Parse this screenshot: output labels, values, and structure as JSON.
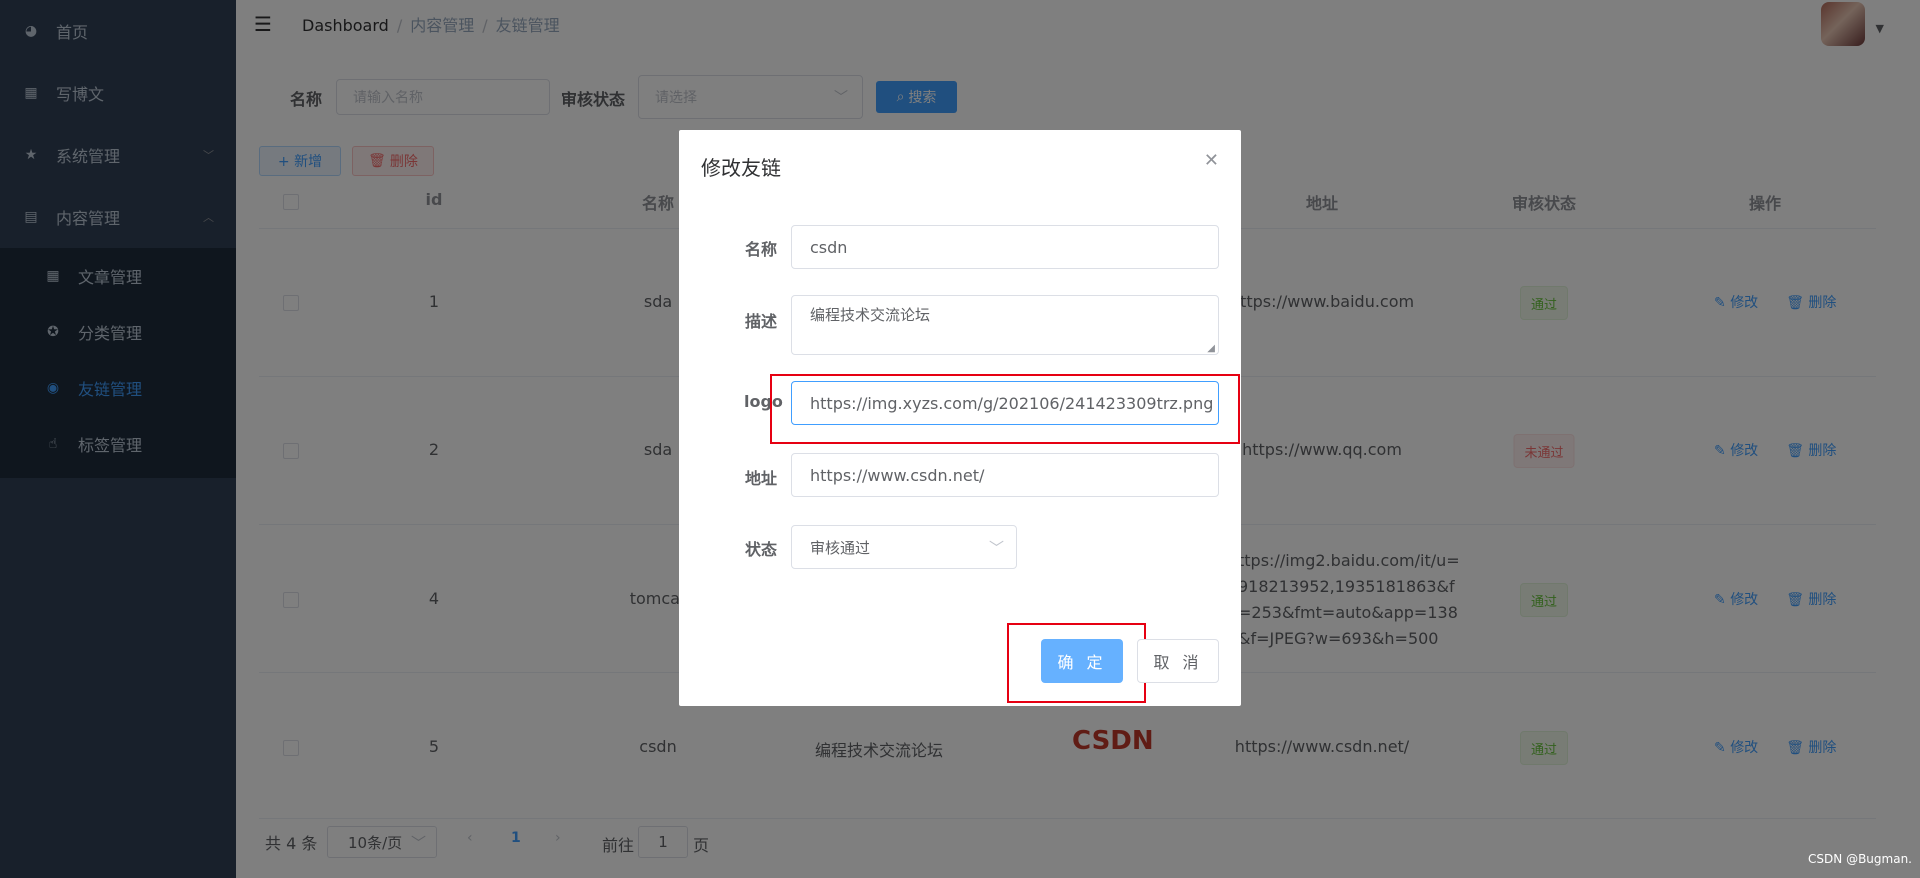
{
  "sidebar": {
    "items": [
      {
        "label": "首页",
        "icon": "dashboard-icon"
      },
      {
        "label": "写博文",
        "icon": "edit-icon"
      },
      {
        "label": "系统管理",
        "icon": "star-icon"
      },
      {
        "label": "内容管理",
        "icon": "table-icon"
      }
    ],
    "sub_items": [
      {
        "label": "文章管理",
        "icon": "grid-icon"
      },
      {
        "label": "分类管理",
        "icon": "category-icon"
      },
      {
        "label": "友链管理",
        "icon": "link-icon"
      },
      {
        "label": "标签管理",
        "icon": "tag-icon"
      }
    ]
  },
  "header": {
    "breadcrumb": [
      "Dashboard",
      "内容管理",
      "友链管理"
    ]
  },
  "filter": {
    "name_label": "名称",
    "name_placeholder": "请输入名称",
    "status_label": "审核状态",
    "status_placeholder": "请选择",
    "search_label": "搜索"
  },
  "toolbar": {
    "add_label": "+ 新增",
    "delete_label": "删除"
  },
  "table": {
    "headers": [
      "id",
      "名称",
      "地址",
      "审核状态",
      "操作"
    ],
    "rows": [
      {
        "id": "1",
        "name": "sda",
        "url": "https://www.baidu.com",
        "status": "通过"
      },
      {
        "id": "2",
        "name": "sda",
        "url": "https://www.qq.com",
        "status": "未通过"
      },
      {
        "id": "4",
        "name": "tomcat",
        "url_lines": [
          "ttps://img2.baidu.com/it/u=",
          "918213952,1935181863&f",
          "=253&fmt=auto&app=138",
          "&f=JPEG?w=693&h=500"
        ],
        "status": "通过"
      },
      {
        "id": "5",
        "name": "csdn",
        "desc": "编程技术交流论坛",
        "logo_text": "CSDN",
        "url": "https://www.csdn.net/",
        "status": "通过"
      }
    ],
    "edit_label": "修改",
    "delete_label": "删除"
  },
  "pagination": {
    "total": "共 4 条",
    "page_size": "10条/页",
    "current_page": "1",
    "goto_label": "前往",
    "goto_value": "1",
    "page_unit": "页"
  },
  "dialog": {
    "title": "修改友链",
    "fields": {
      "name_label": "名称",
      "name_value": "csdn",
      "desc_label": "描述",
      "desc_value": "编程技术交流论坛",
      "logo_label": "logo",
      "logo_value": "https://img.xyzs.com/g/202106/241423309trz.png",
      "url_label": "地址",
      "url_value": "https://www.csdn.net/",
      "status_label": "状态",
      "status_value": "审核通过"
    },
    "ok_label": "确 定",
    "cancel_label": "取 消"
  },
  "watermark": "CSDN @Bugman.",
  "colors": {
    "primary": "#409eff",
    "sidebar": "#304156",
    "highlight": "#e60012"
  }
}
